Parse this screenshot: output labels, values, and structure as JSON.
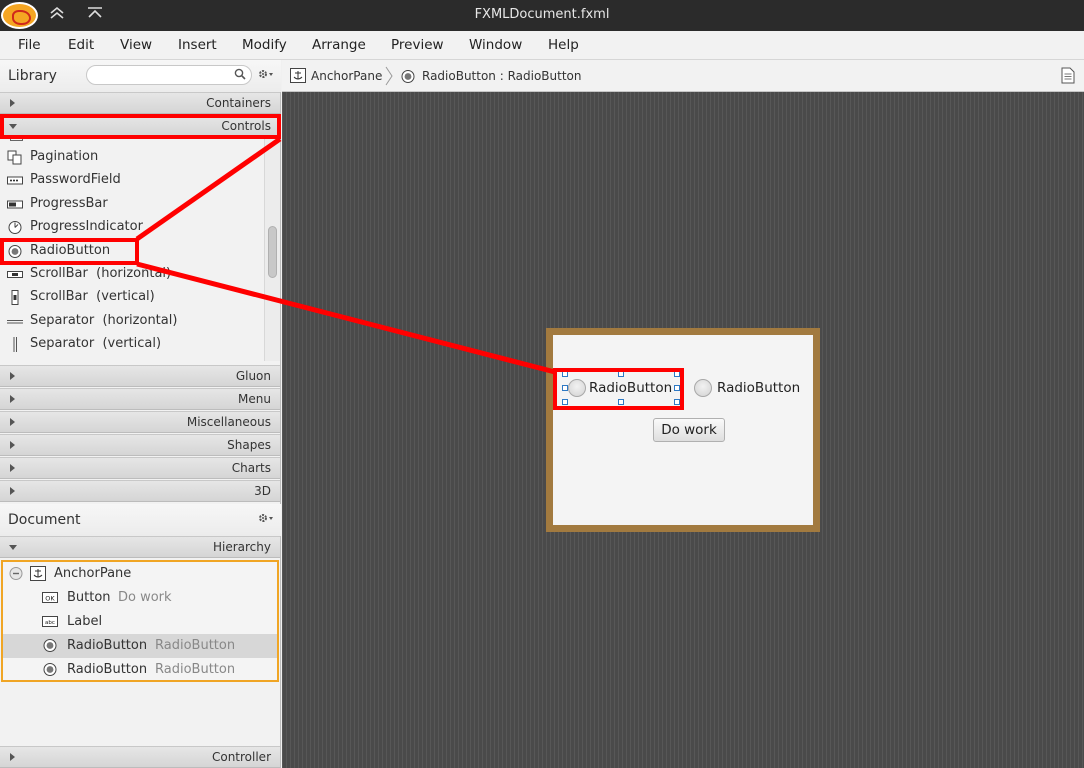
{
  "window": {
    "title": "FXMLDocument.fxml"
  },
  "menubar": {
    "items": [
      "File",
      "Edit",
      "View",
      "Insert",
      "Modify",
      "Arrange",
      "Preview",
      "Window",
      "Help"
    ]
  },
  "library": {
    "title": "Library",
    "search_placeholder": "",
    "sections_top": [
      {
        "label": "Containers",
        "expanded": false
      },
      {
        "label": "Controls",
        "expanded": true
      }
    ],
    "controls": [
      {
        "label": "Pagination",
        "icon": "pagination-icon"
      },
      {
        "label": "PasswordField",
        "icon": "password-field-icon"
      },
      {
        "label": "ProgressBar",
        "icon": "progress-bar-icon"
      },
      {
        "label": "ProgressIndicator",
        "icon": "progress-indicator-icon"
      },
      {
        "label": "RadioButton",
        "icon": "radio-button-icon"
      },
      {
        "label": "ScrollBar  (horizontal)",
        "icon": "scrollbar-horizontal-icon"
      },
      {
        "label": "ScrollBar  (vertical)",
        "icon": "scrollbar-vertical-icon"
      },
      {
        "label": "Separator  (horizontal)",
        "icon": "separator-horizontal-icon"
      },
      {
        "label": "Separator  (vertical)",
        "icon": "separator-vertical-icon"
      }
    ],
    "sections_bottom": [
      "Gluon",
      "Menu",
      "Miscellaneous",
      "Shapes",
      "Charts",
      "3D"
    ]
  },
  "document": {
    "title": "Document",
    "hierarchy_label": "Hierarchy",
    "controller_label": "Controller",
    "hierarchy": [
      {
        "name": "AnchorPane",
        "value": "",
        "icon": "anchor-pane-icon"
      },
      {
        "name": "Button",
        "value": "Do work",
        "icon": "button-icon"
      },
      {
        "name": "Label",
        "value": "",
        "icon": "label-icon"
      },
      {
        "name": "RadioButton",
        "value": "RadioButton",
        "icon": "radio-button-icon"
      },
      {
        "name": "RadioButton",
        "value": "RadioButton",
        "icon": "radio-button-icon"
      }
    ]
  },
  "breadcrumb": {
    "items": [
      "AnchorPane",
      "RadioButton : RadioButton"
    ]
  },
  "design": {
    "radio1_label": "RadioButton",
    "radio2_label": "RadioButton",
    "button_label": "Do work"
  },
  "colors": {
    "highlight": "#ff0000",
    "hierarchy_border": "#f0a524",
    "stage_border": "#a27a3f"
  }
}
